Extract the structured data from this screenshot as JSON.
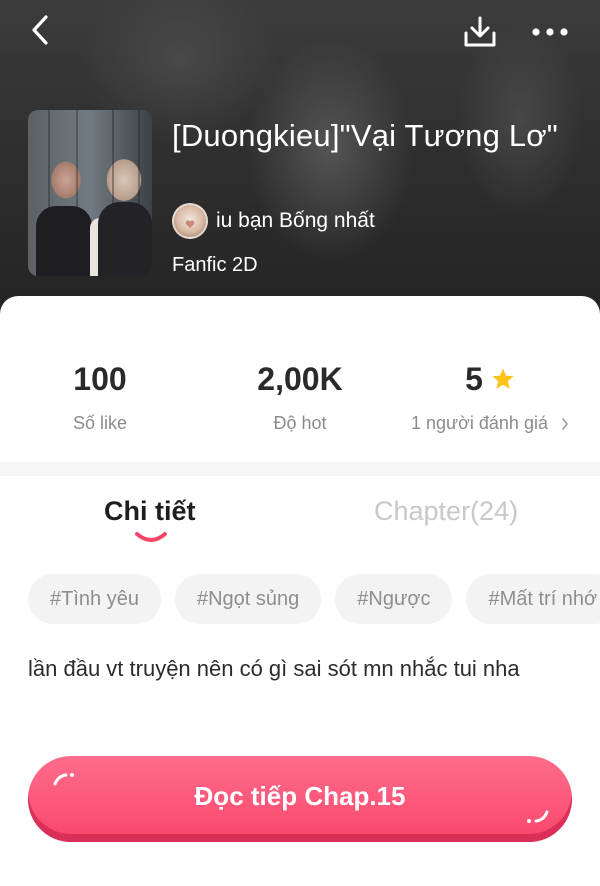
{
  "story": {
    "title": "[Duongkieu]\"Vại Tương Lơ\"",
    "author": "iu bạn Bống nhất",
    "genre": "Fanfic 2D"
  },
  "stats": [
    {
      "value": "100",
      "label": "Số like"
    },
    {
      "value": "2,00K",
      "label": "Độ hot"
    },
    {
      "value": "5",
      "label": "1 người đánh giá"
    }
  ],
  "tabs": {
    "details": "Chi tiết",
    "chapters": "Chapter(24)"
  },
  "tags": [
    "#Tình yêu",
    "#Ngọt sủng",
    "#Ngược",
    "#Mất trí nhớ"
  ],
  "description": "lần đầu vt truyện nên có gì sai sót mn nhắc tui nha",
  "cta": {
    "label": "Đọc tiếp Chap.15"
  },
  "colors": {
    "accent": "#f8466b",
    "star": "#ffc21a",
    "tab_indicator": "#f8466b"
  },
  "icons": {
    "back": "chevron-left-icon",
    "download": "download-icon",
    "more": "more-horizontal-icon",
    "star": "star-icon"
  }
}
